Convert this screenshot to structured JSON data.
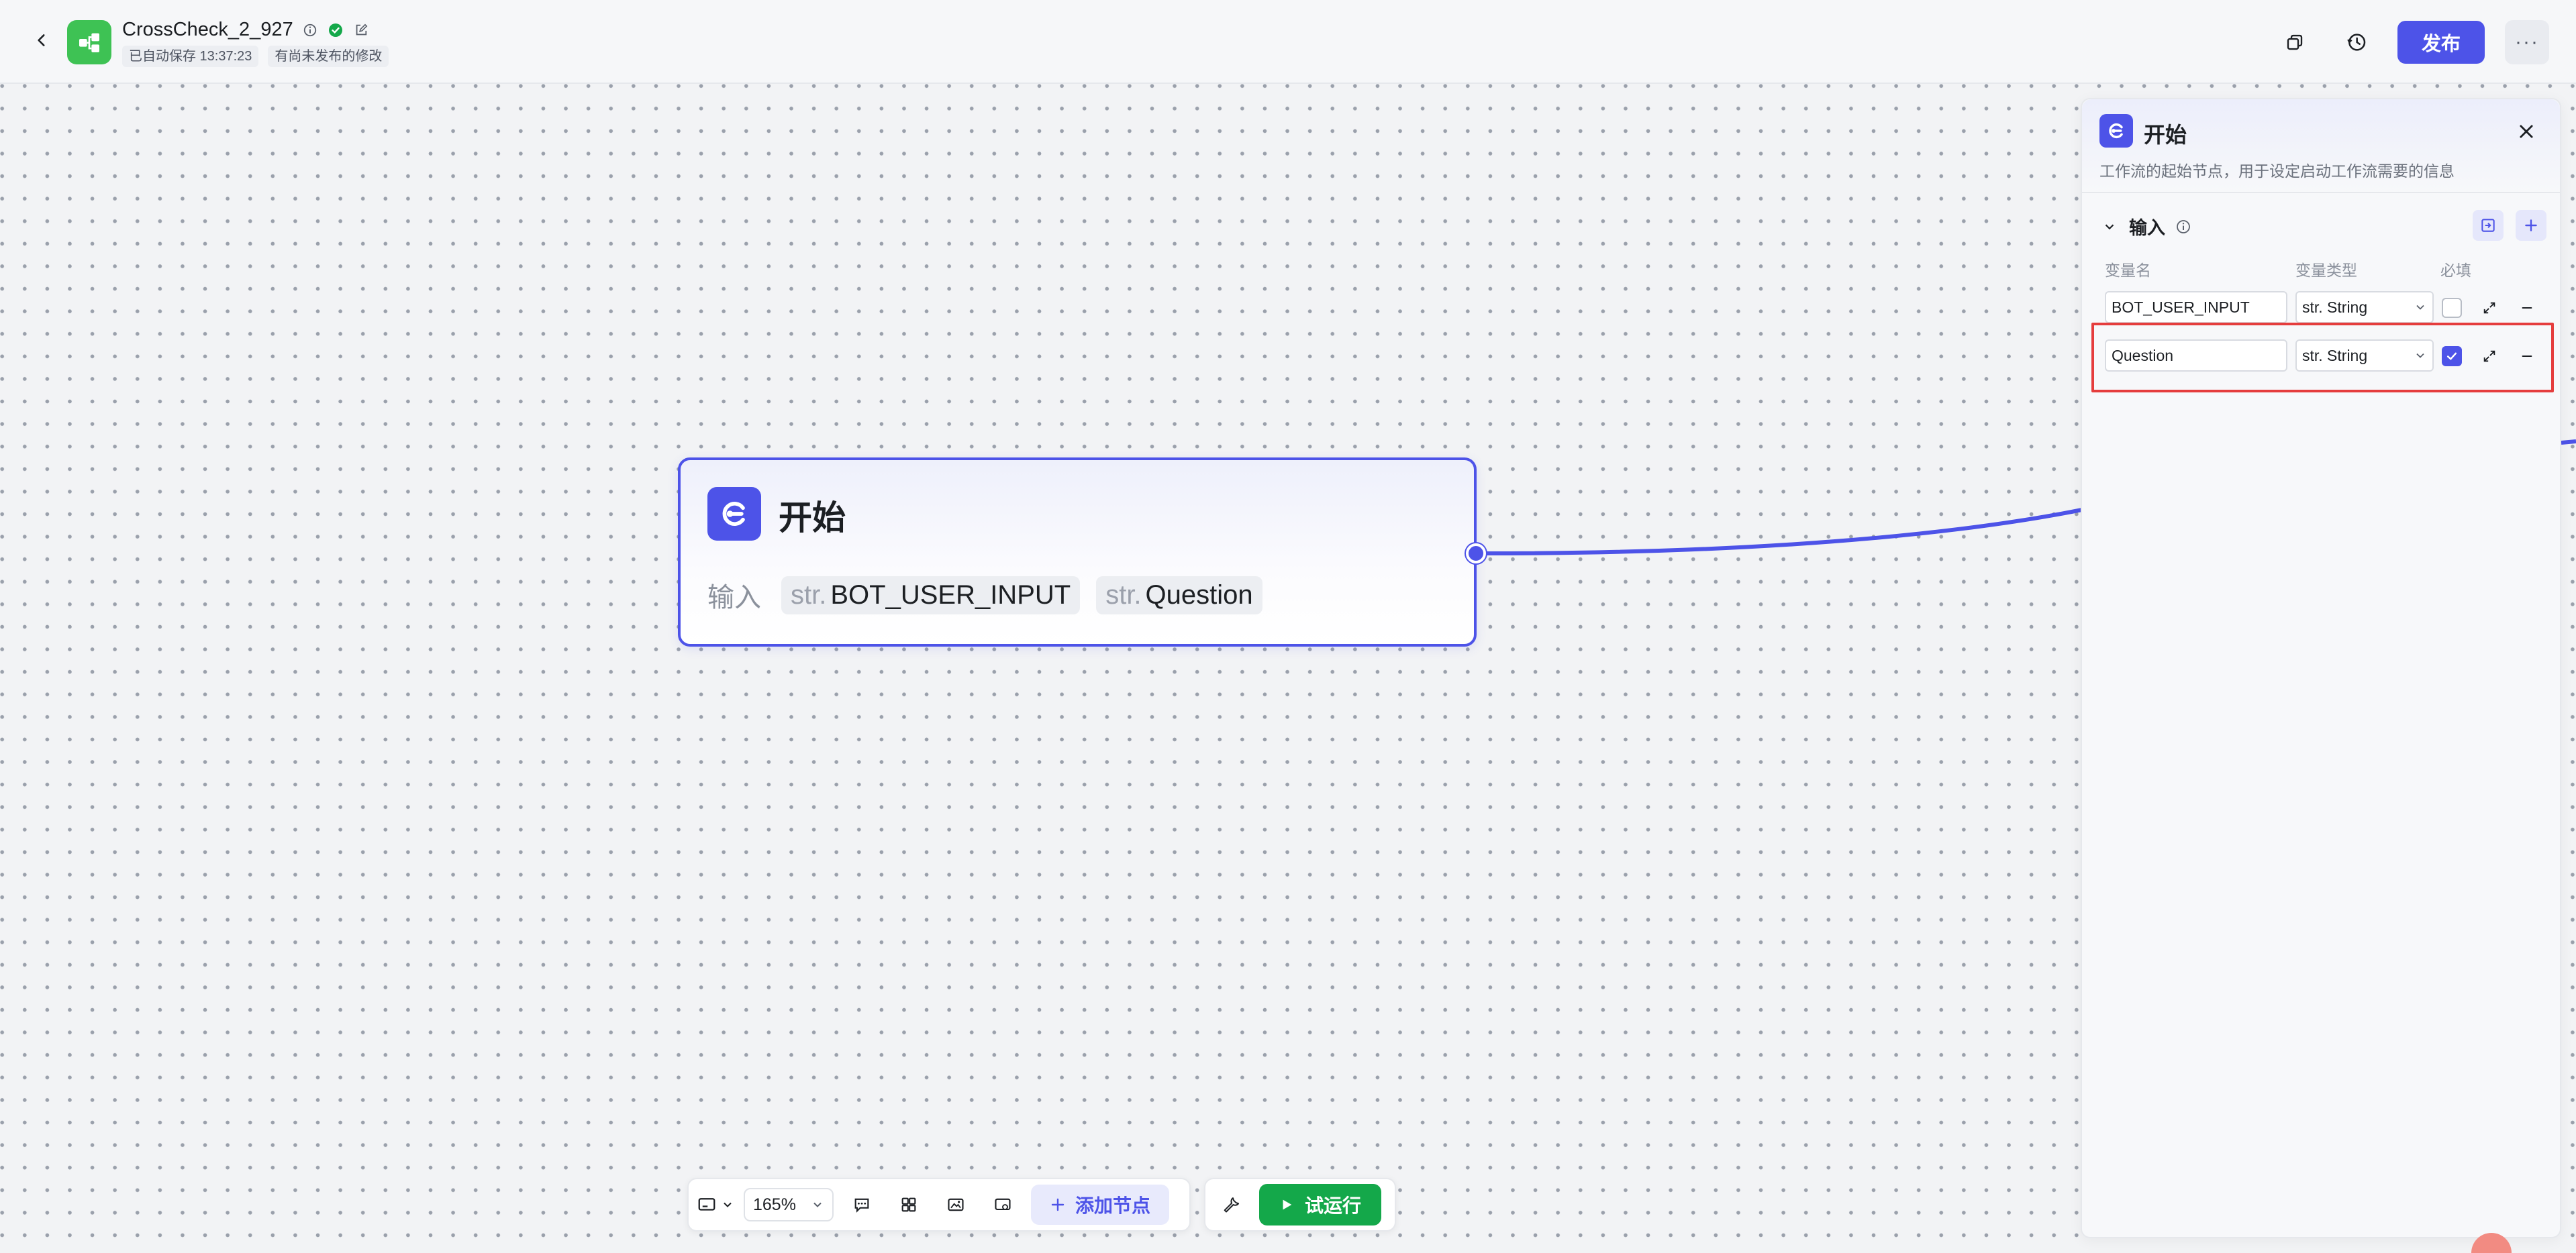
{
  "header": {
    "app_title": "CrossCheck_2_927",
    "autosave_badge": "已自动保存 13:37:23",
    "unpublished_badge": "有尚未发布的修改",
    "publish_label": "发布",
    "more_label": "···"
  },
  "node": {
    "title": "开始",
    "inputs_label": "输入",
    "inputs": [
      {
        "type": "str.",
        "name": "BOT_USER_INPUT"
      },
      {
        "type": "str.",
        "name": "Question"
      }
    ]
  },
  "toolbar": {
    "zoom": "165%",
    "add_node_label": "添加节点",
    "run_label": "试运行"
  },
  "panel": {
    "title": "开始",
    "description": "工作流的起始节点，用于设定启动工作流需要的信息",
    "section_title": "输入",
    "columns": {
      "name": "变量名",
      "type": "变量类型",
      "required": "必填"
    },
    "rows": [
      {
        "name": "BOT_USER_INPUT",
        "type": "str. String",
        "required": false
      },
      {
        "name": "Question",
        "type": "str. String",
        "required": true
      }
    ]
  },
  "colors": {
    "accent": "#4d53e8",
    "app_icon": "#3ec254",
    "run": "#14a84a",
    "highlight": "#e53d3d"
  },
  "icons": {
    "back": "chevron-left-icon",
    "info": "info-icon",
    "status": "check-circle-icon",
    "edit": "edit-icon",
    "copy": "copy-icon",
    "history": "history-icon",
    "close": "close-icon",
    "expand": "expand-icon",
    "remove": "minus-icon",
    "add": "plus-icon"
  }
}
